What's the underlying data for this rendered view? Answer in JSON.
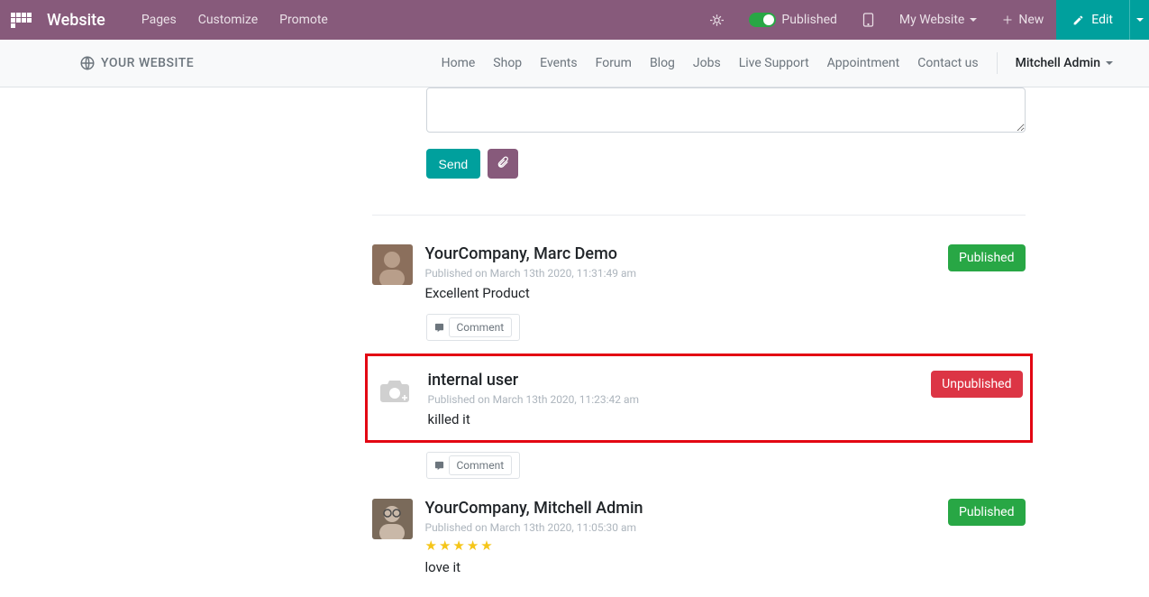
{
  "topbar": {
    "brand": "Website",
    "menu": {
      "pages": "Pages",
      "customize": "Customize",
      "promote": "Promote"
    },
    "published": "Published",
    "mywebsite": "My Website",
    "new": "New",
    "edit": "Edit"
  },
  "subnav": {
    "logo": "YOUR WEBSITE",
    "menu": {
      "home": "Home",
      "shop": "Shop",
      "events": "Events",
      "forum": "Forum",
      "blog": "Blog",
      "jobs": "Jobs",
      "live": "Live Support",
      "appointment": "Appointment",
      "contact": "Contact us",
      "user": "Mitchell Admin"
    }
  },
  "compose": {
    "send": "Send"
  },
  "comment_label": "Comment",
  "status": {
    "published": "Published",
    "unpublished": "Unpublished"
  },
  "comments": [
    {
      "name": "YourCompany, Marc Demo",
      "date": "Published on March 13th 2020, 11:31:49 am",
      "text": "Excellent Product",
      "status": "published"
    },
    {
      "name": "internal user",
      "date": "Published on March 13th 2020, 11:23:42 am",
      "text": "killed it",
      "status": "unpublished",
      "highlight": true
    },
    {
      "name": "YourCompany, Mitchell Admin",
      "date": "Published on March 13th 2020, 11:05:30 am",
      "text": "love it",
      "status": "published",
      "stars": 5
    }
  ]
}
